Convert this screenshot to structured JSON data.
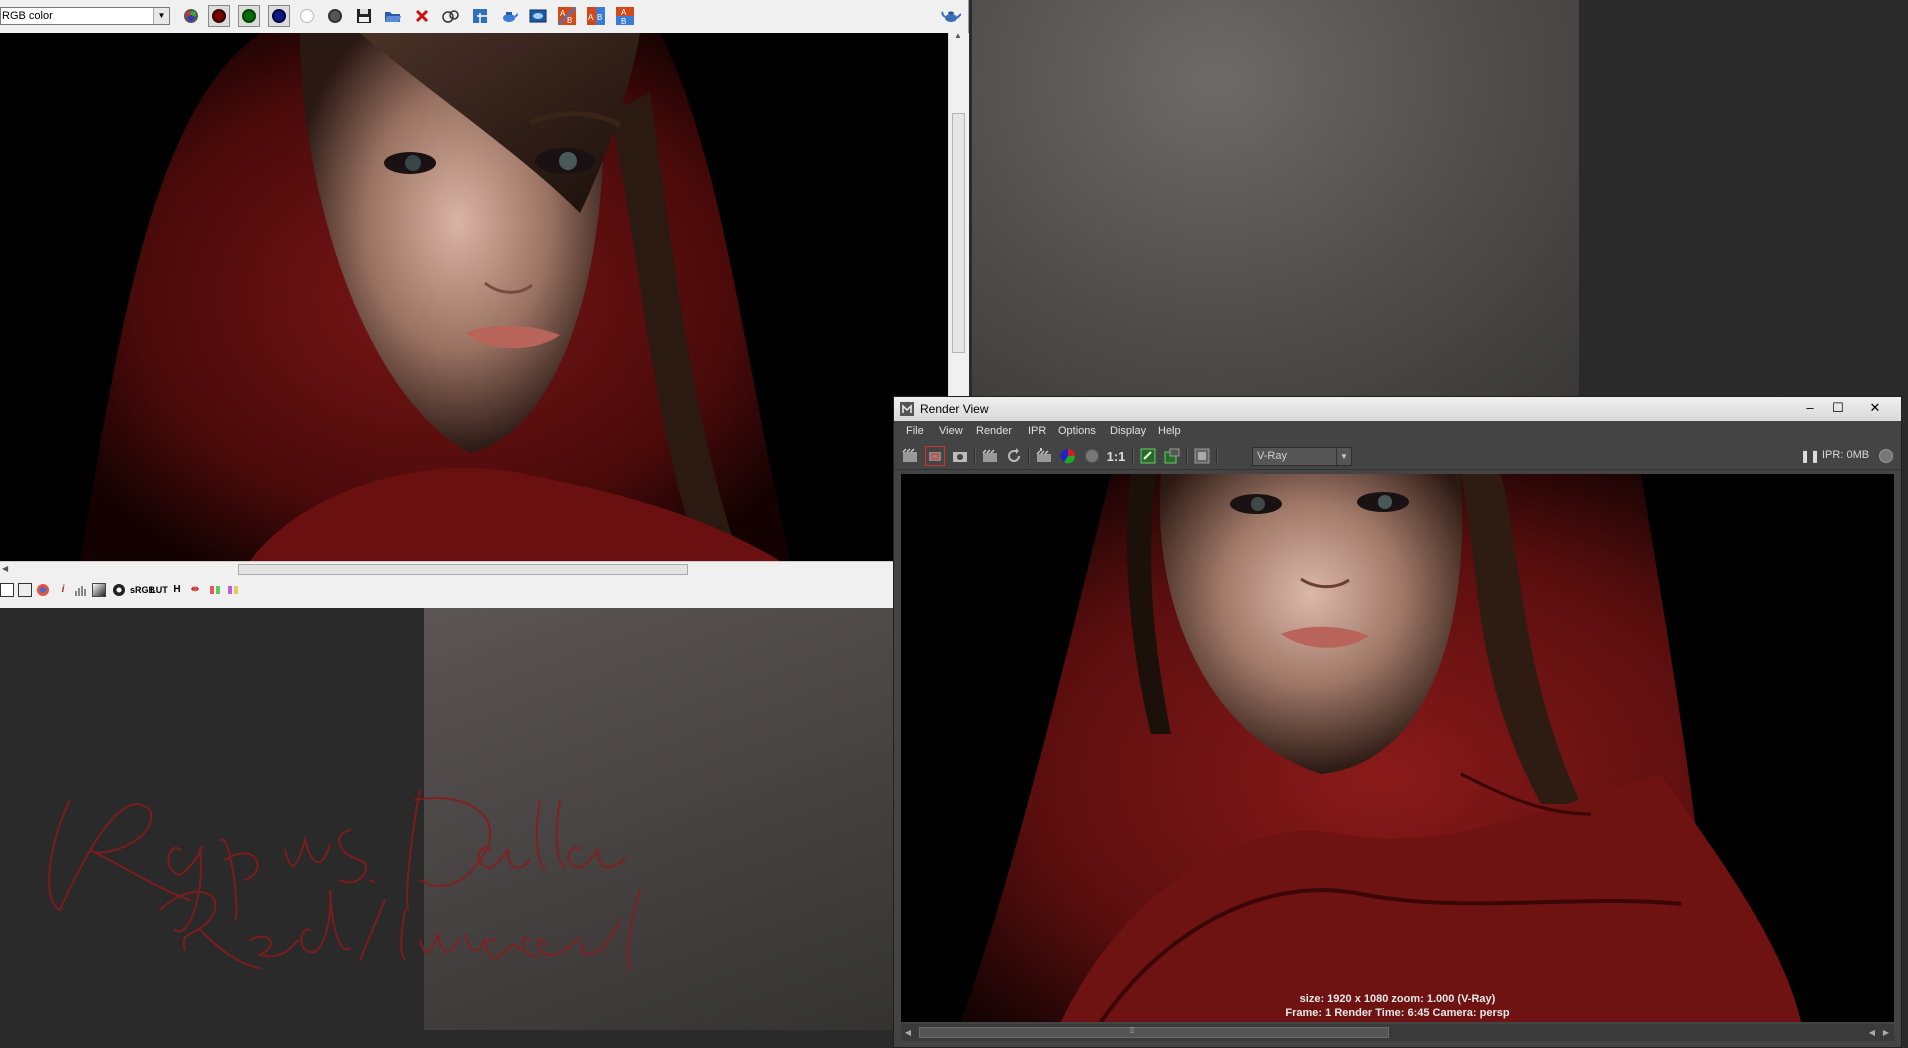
{
  "framebuffer": {
    "channel_select": "RGB color",
    "toolbar_icons": [
      "rgb-channels-icon",
      "red-channel-icon",
      "green-channel-icon",
      "blue-channel-icon",
      "alpha-channel-icon",
      "monochrome-icon",
      "save-image-icon",
      "open-image-icon",
      "clear-image-icon",
      "track-mouse-icon",
      "region-render-icon",
      "render-last-icon",
      "show-history-icon",
      "ab-compare-horizontal-icon",
      "ab-compare-vertical-icon",
      "ab-compare-swap-icon",
      "teapot-render-icon"
    ],
    "bottom_icons": [
      "display-color-correction-icon",
      "levels-icon",
      "curves-icon",
      "info-icon",
      "histogram-icon",
      "exposure-icon",
      "white-balance-icon",
      "srgb-label",
      "lut-label",
      "hsv-label",
      "clamp-icon",
      "red-green-icon",
      "pixel-aspect-icon"
    ],
    "bottom_labels": {
      "srgb": "sRGB",
      "lut": "LUT",
      "hsv": "H",
      "info": "i"
    }
  },
  "render_view": {
    "title": "Render View",
    "menu": [
      "File",
      "View",
      "Render",
      "IPR",
      "Options",
      "Display",
      "Help"
    ],
    "one_to_one": "1:1",
    "renderer_select": "V-Ray",
    "ipr_status": "IPR: 0MB",
    "info_line1": "size: 1920 x 1080 zoom: 1.000      (V-Ray)",
    "info_line2": "Frame: 1      Render Time:  6:45      Camera: persp"
  },
  "colors": {
    "accent_red": "#8b1a1a",
    "dark_bg": "#2a2a2a",
    "render_view_chrome": "#444444"
  }
}
